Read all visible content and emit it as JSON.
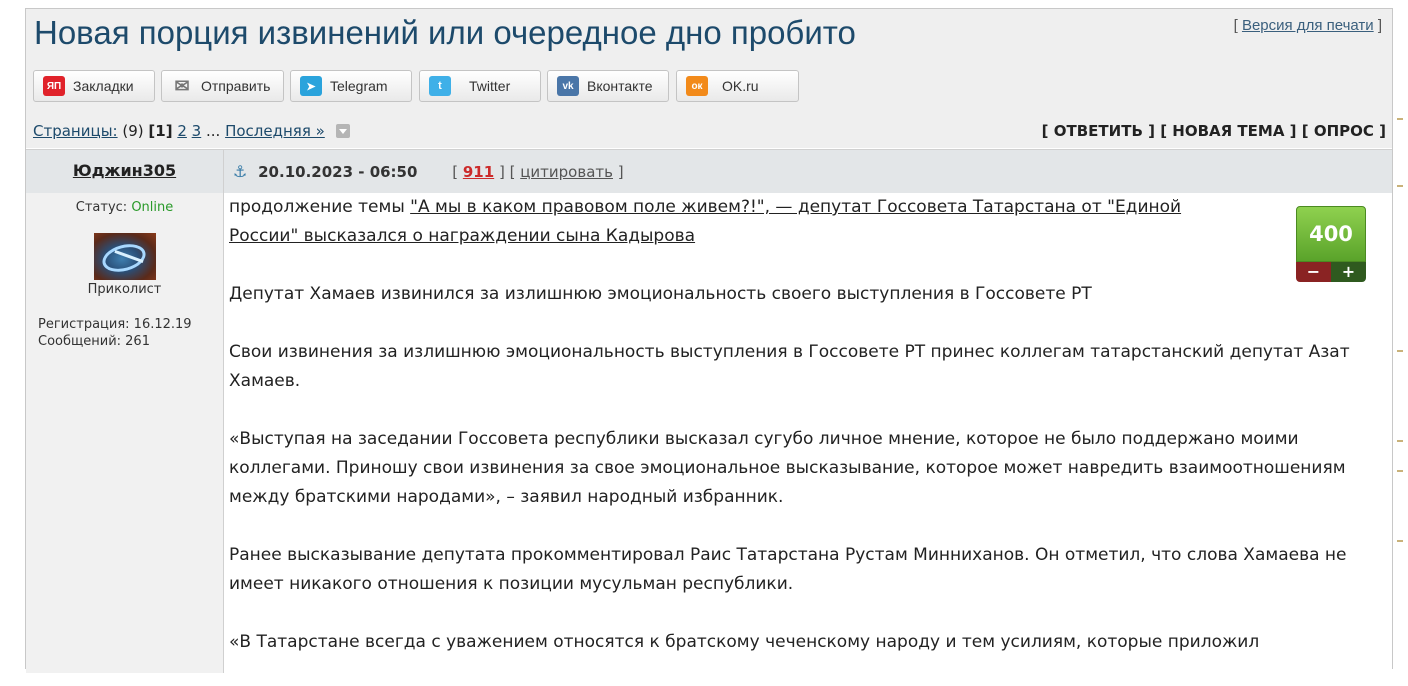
{
  "topic": {
    "title": "Новая порция извинений или очередное дно пробито",
    "print_bracket_open": "[",
    "print_link": "Версия для печати",
    "print_bracket_close": "]"
  },
  "share": [
    {
      "label": "Закладки",
      "icon": "yandex-bookmarks-icon",
      "glyph": "ЯП",
      "color": "#e0222a"
    },
    {
      "label": "Отправить",
      "icon": "envelope-icon",
      "glyph": "✉",
      "color": "#8a8a8a"
    },
    {
      "label": "Telegram",
      "icon": "telegram-icon",
      "glyph": "➤",
      "color": "#2aa3dc"
    },
    {
      "label": "Twitter",
      "icon": "twitter-icon",
      "glyph": "t",
      "color": "#3fb0e8"
    },
    {
      "label": "Вконтакте",
      "icon": "vk-icon",
      "glyph": "vk",
      "color": "#4a76a8"
    },
    {
      "label": "OK.ru",
      "icon": "ok-icon",
      "glyph": "ок",
      "color": "#f28a1a"
    }
  ],
  "pagination": {
    "label": "Страницы:",
    "count": "(9)",
    "current": "[1]",
    "pages": [
      "2",
      "3"
    ],
    "ellipsis": "...",
    "last": "Последняя »"
  },
  "actions": {
    "reply": "ОТВЕТИТЬ",
    "new_topic": "НОВАЯ ТЕМА",
    "poll": "ОПРОС"
  },
  "post": {
    "author": "Юджин305",
    "date": "20.10.2023 - 06:50",
    "number": "911",
    "quote": "цитировать",
    "rating": "400",
    "minus": "−",
    "plus": "+"
  },
  "user": {
    "status_label": "Статус:",
    "status_value": "Online",
    "rank": "Приколист",
    "registration": "Регистрация: 16.12.19",
    "messages": "Сообщений: 261"
  },
  "content": {
    "intro_text": "продолжение темы ",
    "intro_link": "\"А мы в каком правовом поле живем?!\", — депутат Госсовета Татарстана от \"Единой России\" высказался о награждении сына Кадырова",
    "p1": "Депутат Хамаев извинился за излишнюю эмоциональность своего выступления в Госсовете РТ",
    "p2": "Свои извинения за излишнюю эмоциональность выступления в Госсовете РТ принес коллегам татарстанский депутат Азат Хамаев.",
    "p3": "«Выступая на заседании Госсовета республики высказал сугубо личное мнение, которое не было поддержано моими коллегами. Приношу свои извинения за свое эмоциональное высказывание, которое может навредить взаимоотношениям между братскими народами», – заявил народный избранник.",
    "p4": "Ранее высказывание депутата прокомментировал Раис Татарстана Рустам Минниханов. Он отметил, что слова Хамаева не имеет никакого отношения к позиции мусульман республики.",
    "p5": "«В Татарстане всегда с уважением относятся к братскому чеченскому народу и тем усилиям, которые приложил"
  }
}
